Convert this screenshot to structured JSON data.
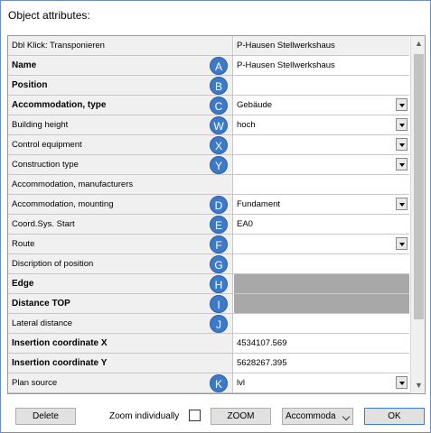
{
  "title": "Object attributes:",
  "header": {
    "label": "Dbl Klick: Transponieren",
    "value": "P-Hausen Stellwerkshaus"
  },
  "rows": [
    {
      "label": "Name",
      "bold": true,
      "badge": "A",
      "value": "P-Hausen Stellwerkshaus",
      "dropdown": false,
      "grey": false
    },
    {
      "label": "Position",
      "bold": true,
      "badge": "B",
      "value": "",
      "dropdown": false,
      "grey": false
    },
    {
      "label": "Accommodation, type",
      "bold": true,
      "badge": "C",
      "value": "Gebäude",
      "dropdown": true,
      "grey": false
    },
    {
      "label": "Building height",
      "bold": false,
      "badge": "W",
      "value": "hoch",
      "dropdown": true,
      "grey": false
    },
    {
      "label": "Control equipment",
      "bold": false,
      "badge": "X",
      "value": "",
      "dropdown": true,
      "grey": false
    },
    {
      "label": "Construction type",
      "bold": false,
      "badge": "Y",
      "value": "",
      "dropdown": true,
      "grey": false
    },
    {
      "label": "Accommodation, manufacturers",
      "bold": false,
      "badge": "",
      "value": "",
      "dropdown": false,
      "grey": false
    },
    {
      "label": "Accommodation, mounting",
      "bold": false,
      "badge": "D",
      "value": "Fundament",
      "dropdown": true,
      "grey": false
    },
    {
      "label": "Coord.Sys. Start",
      "bold": false,
      "badge": "E",
      "value": "EA0",
      "dropdown": false,
      "grey": false
    },
    {
      "label": "Route",
      "bold": false,
      "badge": "F",
      "value": "",
      "dropdown": true,
      "grey": false
    },
    {
      "label": "Discription of position",
      "bold": false,
      "badge": "G",
      "value": "",
      "dropdown": false,
      "grey": false
    },
    {
      "label": "Edge",
      "bold": true,
      "badge": "H",
      "value": "",
      "dropdown": false,
      "grey": true
    },
    {
      "label": "Distance TOP",
      "bold": true,
      "badge": "I",
      "value": "",
      "dropdown": false,
      "grey": true
    },
    {
      "label": "Lateral distance",
      "bold": false,
      "badge": "J",
      "value": "",
      "dropdown": false,
      "grey": false
    },
    {
      "label": "Insertion coordinate X",
      "bold": true,
      "badge": "",
      "value": "4534107.569",
      "dropdown": false,
      "grey": false
    },
    {
      "label": "Insertion coordinate Y",
      "bold": true,
      "badge": "",
      "value": "5628267.395",
      "dropdown": false,
      "grey": false
    },
    {
      "label": "Plan source",
      "bold": false,
      "badge": "K",
      "value": "lvl",
      "dropdown": true,
      "grey": false
    }
  ],
  "footer": {
    "delete_label": "Delete",
    "zoom_individually_label": "Zoom individually",
    "zoom_label": "ZOOM",
    "select_value": "Accommoda",
    "ok_label": "OK"
  },
  "icons": {
    "scroll_up": "chevron-up-icon",
    "scroll_down": "chevron-down-icon",
    "dropdown": "dropdown-arrow-icon"
  },
  "colors": {
    "badge": "#3d79c9",
    "window_border": "#6b8fc4",
    "label_bg": "#f0f0f0",
    "disabled_value_bg": "#a8a8a8"
  }
}
